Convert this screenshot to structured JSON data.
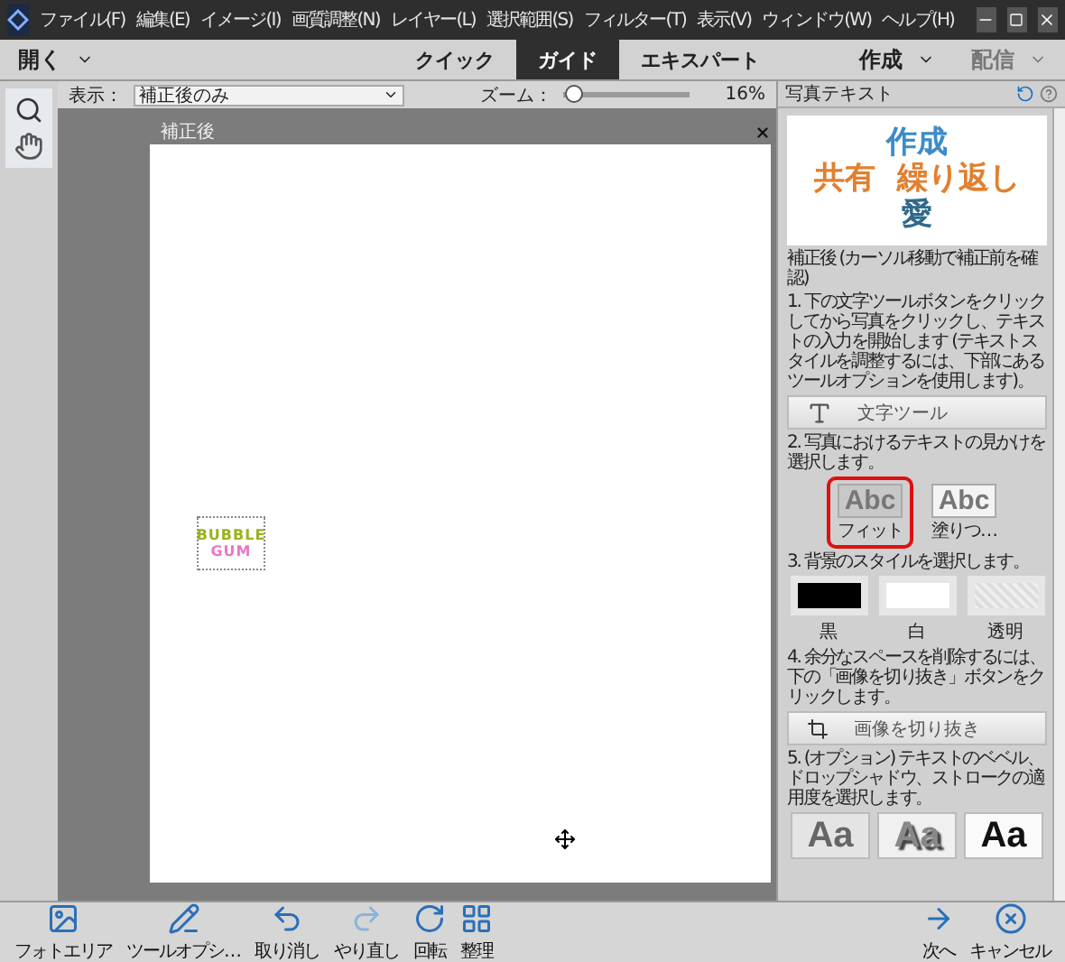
{
  "menu": [
    "ファイル(F)",
    "編集(E)",
    "イメージ(I)",
    "画質調整(N)",
    "レイヤー(L)",
    "選択範囲(S)",
    "フィルター(T)",
    "表示(V)",
    "ウィンドウ(W)",
    "ヘルプ(H)"
  ],
  "mode_bar": {
    "open": "開く",
    "tabs": [
      {
        "label": "クイック",
        "selected": false
      },
      {
        "label": "ガイド",
        "selected": true
      },
      {
        "label": "エキスパート",
        "selected": false
      }
    ],
    "create": "作成",
    "share": "配信"
  },
  "options": {
    "view_label": "表示：",
    "view_value": "補正後のみ",
    "zoom_label": "ズーム：",
    "zoom": {
      "level": 0.02
    },
    "zoom_value": "16%"
  },
  "canvas": {
    "doc_label": "補正後",
    "text_lines": [
      "BUBBLE",
      "GUM"
    ]
  },
  "panel": {
    "title": "写真テキスト",
    "preview_lines": [
      [
        "作成"
      ],
      [
        "共有",
        "繰り返し"
      ],
      [
        "愛"
      ]
    ],
    "caption": "補正後 (カーソル移動で補正前を確認)",
    "step1": "1. 下の文字ツールボタンをクリックしてから写真をクリックし、テキストの入力を開始します (テキストスタイルを調整するには、下部にあるツールオプションを使用します)。",
    "type_tool": "文字ツール",
    "step2": "2. 写真におけるテキストの見かけを選択します。",
    "looks": [
      {
        "sample": "Abc",
        "label": "フィット",
        "selected": true
      },
      {
        "sample": "Abc",
        "label": "塗りつ…",
        "selected": false
      }
    ],
    "step3": "3. 背景のスタイルを選択します。",
    "backgrounds": [
      {
        "kind": "black",
        "label": "黒"
      },
      {
        "kind": "white",
        "label": "白"
      },
      {
        "kind": "transparent",
        "label": "透明"
      }
    ],
    "step4": "4. 余分なスペースを削除するには、下の「画像を切り抜き」ボタンをクリックします。",
    "crop": "画像を切り抜き",
    "step5": "5. (オプション) テキストのベベル、ドロップシャドウ、ストロークの適用度を選択します。",
    "styles": [
      {
        "kind": "bevel",
        "sample": "Aa"
      },
      {
        "kind": "shadow",
        "sample": "Aa"
      },
      {
        "kind": "stroke",
        "sample": "Aa"
      }
    ]
  },
  "bottom_bar": [
    {
      "kind": "photo",
      "label": "フォトエリア"
    },
    {
      "kind": "options",
      "label": "ツールオプシ…"
    },
    {
      "kind": "undo",
      "label": "取り消し"
    },
    {
      "kind": "redo",
      "label": "やり直し"
    },
    {
      "kind": "rotate",
      "label": "回転"
    },
    {
      "kind": "organize",
      "label": "整理"
    },
    {
      "kind": "next",
      "label": "次へ"
    },
    {
      "kind": "cancel",
      "label": "キャンセル"
    }
  ]
}
